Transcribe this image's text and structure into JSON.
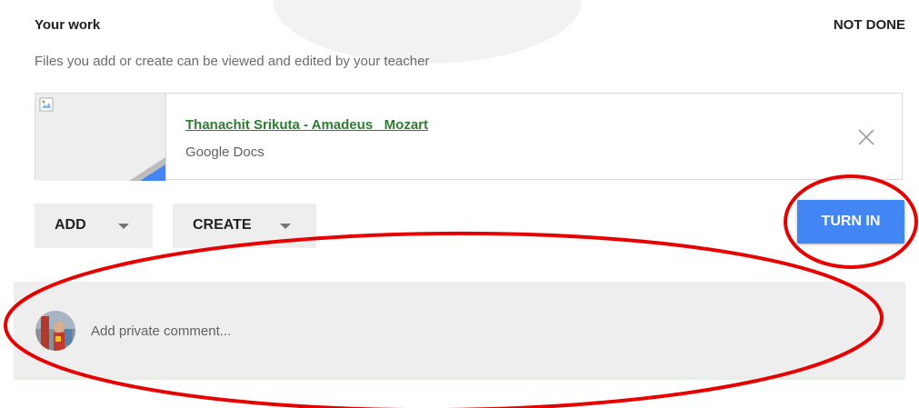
{
  "header": {
    "title": "Your work",
    "status": "NOT DONE"
  },
  "subtitle": "Files you add or create can be viewed and edited by your teacher",
  "attachment": {
    "title": "Thanachit Srikuta - Amadeus_ Mozart",
    "type": "Google Docs",
    "thumbnail_icon": "broken-image-icon",
    "remove_icon": "close-icon"
  },
  "actions": {
    "add_label": "ADD",
    "create_label": "CREATE",
    "turn_in_label": "TURN IN"
  },
  "comment": {
    "placeholder": "Add private comment..."
  },
  "colors": {
    "accent": "#4285f4",
    "link": "#2e7d32",
    "annotation": "#e60000",
    "button_bg": "#eeeeee"
  }
}
